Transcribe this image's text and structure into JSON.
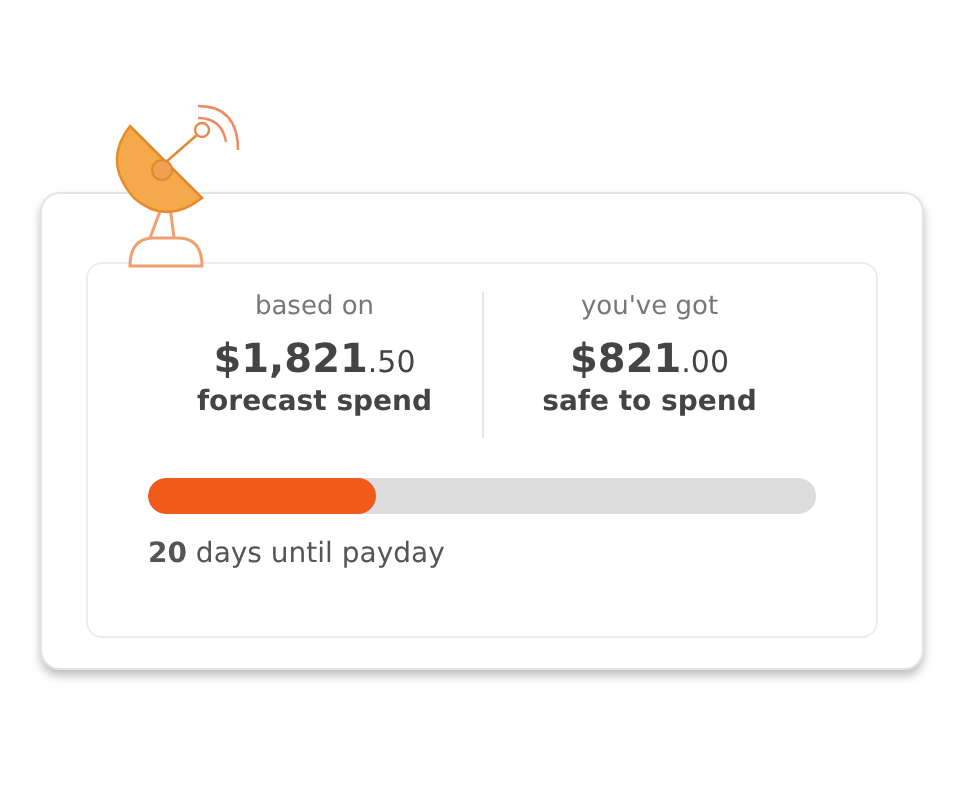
{
  "stats": [
    {
      "caption": "based on",
      "amount": "$1,821",
      "cents": ".50",
      "label": "forecast spend"
    },
    {
      "caption": "you've got",
      "amount": "$821",
      "cents": ".00",
      "label": "safe to spend"
    }
  ],
  "progress": {
    "level": 0.34,
    "text": "**20** days until payday"
  }
}
